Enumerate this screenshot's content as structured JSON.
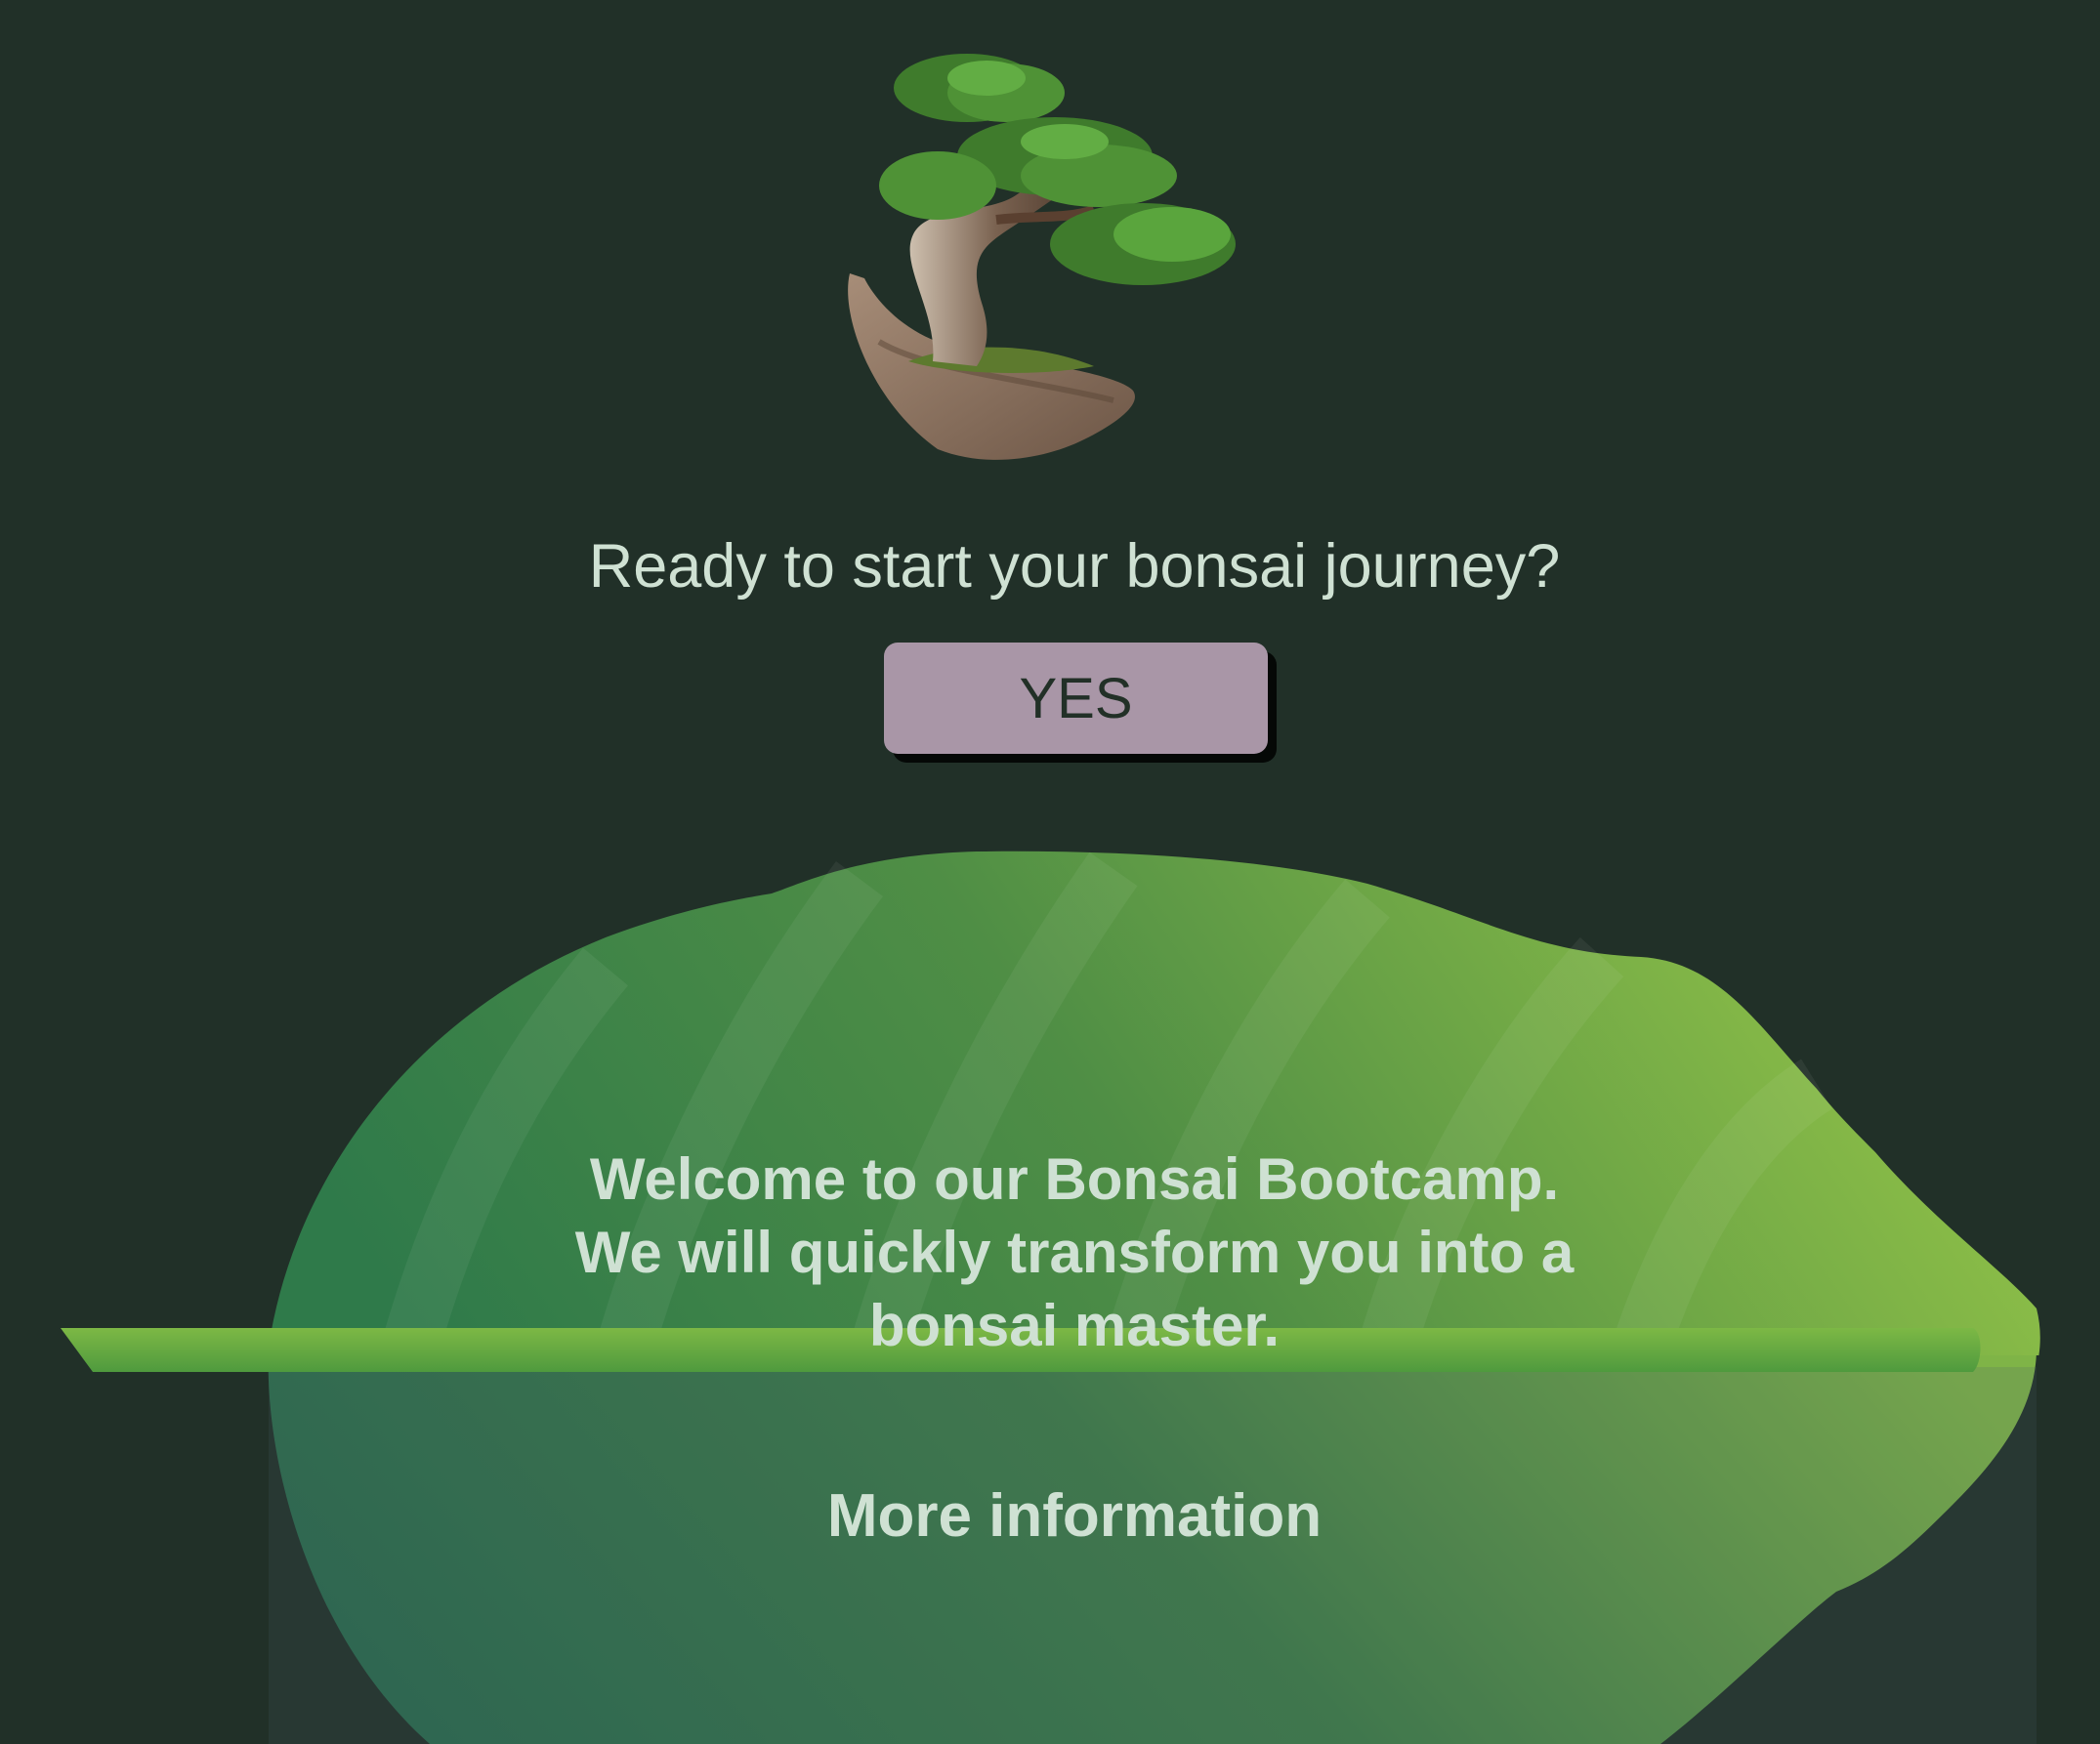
{
  "hero": {
    "image_icon": "bonsai-tree-icon",
    "question": "Ready to start your bonsai journey?",
    "yes_label": "YES"
  },
  "welcome": {
    "lines": [
      "Welcome to our Bonsai Bootcamp.",
      "We will quickly transform you into a",
      "bonsai master."
    ],
    "more_info_label": "More information"
  },
  "colors": {
    "background": "#213028",
    "text": "#cfe1d3",
    "button": "#a996a7",
    "button_text": "#223027",
    "leaf_light": "#95c548",
    "leaf_dark": "#2f6e4c"
  }
}
